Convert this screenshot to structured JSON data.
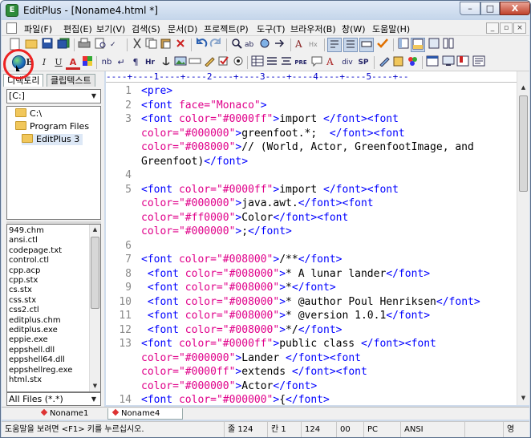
{
  "window": {
    "title": "EditPlus - [Noname4.html *]",
    "app_icon": "E",
    "min": "–",
    "max": "□",
    "close": "X"
  },
  "menu": [
    "파일(F)",
    "편집(E)",
    "보기(V)",
    "검색(S)",
    "문서(D)",
    "프로젝트(P)",
    "도구(T)",
    "브라우저(B)",
    "창(W)",
    "도움말(H)"
  ],
  "mdi_controls": [
    "_",
    "▫",
    "×"
  ],
  "toolbar2": {
    "bold": "B",
    "italic": "I",
    "underline": "U",
    "font_color": "A",
    "nbsp": "nb",
    "br": "↵",
    "para": "¶",
    "hr": "Hr",
    "pre": "PRE",
    "div": "div",
    "span": "SP"
  },
  "left_panel": {
    "tab_directory": "디렉토리",
    "tab_cliptext": "클립텍스트",
    "drive": "[C:]",
    "dirs": [
      "C:\\",
      "Program Files",
      "EditPlus 3"
    ],
    "files": [
      "949.chm",
      "ansi.ctl",
      "codepage.txt",
      "control.ctl",
      "cpp.acp",
      "cpp.stx",
      "cs.stx",
      "css.stx",
      "css2.ctl",
      "editplus.chm",
      "editplus.exe",
      "eppie.exe",
      "eppshell.dll",
      "eppshell64.dll",
      "eppshellreg.exe",
      "html.stx"
    ],
    "filter": "All Files (*.*)"
  },
  "ruler": "----+----1----+----2----+----3----+----4----+----5----+--",
  "editor": {
    "lines": [
      {
        "n": "1",
        "segs": [
          [
            "tag",
            "<pre>"
          ]
        ]
      },
      {
        "n": "2",
        "segs": [
          [
            "tag",
            "<font "
          ],
          [
            "attr",
            "face="
          ],
          [
            "attr",
            "\"Monaco\""
          ],
          [
            "tag",
            ">"
          ]
        ]
      },
      {
        "n": "3",
        "segs": [
          [
            "tag",
            "<font "
          ],
          [
            "attr",
            "color="
          ],
          [
            "attr",
            "\"#0000ff\""
          ],
          [
            "tag",
            ">"
          ],
          [
            "txt",
            "import "
          ],
          [
            "tag",
            "</font><font"
          ]
        ]
      },
      {
        "n": "",
        "segs": [
          [
            "attr",
            "color="
          ],
          [
            "attr",
            "\"#000000\""
          ],
          [
            "tag",
            ">"
          ],
          [
            "txt",
            "greenfoot.*;  "
          ],
          [
            "tag",
            "</font><font"
          ]
        ]
      },
      {
        "n": "",
        "segs": [
          [
            "attr",
            "color="
          ],
          [
            "attr",
            "\"#008000\""
          ],
          [
            "tag",
            ">"
          ],
          [
            "txt",
            "// (World, Actor, GreenfootImage, and"
          ]
        ]
      },
      {
        "n": "",
        "segs": [
          [
            "txt",
            "Greenfoot)"
          ],
          [
            "tag",
            "</font>"
          ]
        ]
      },
      {
        "n": "4",
        "segs": []
      },
      {
        "n": "5",
        "segs": [
          [
            "tag",
            "<font "
          ],
          [
            "attr",
            "color="
          ],
          [
            "attr",
            "\"#0000ff\""
          ],
          [
            "tag",
            ">"
          ],
          [
            "txt",
            "import "
          ],
          [
            "tag",
            "</font><font"
          ]
        ]
      },
      {
        "n": "",
        "segs": [
          [
            "attr",
            "color="
          ],
          [
            "attr",
            "\"#000000\""
          ],
          [
            "tag",
            ">"
          ],
          [
            "txt",
            "java.awt."
          ],
          [
            "tag",
            "</font><font"
          ]
        ]
      },
      {
        "n": "",
        "segs": [
          [
            "attr",
            "color="
          ],
          [
            "attr",
            "\"#ff0000\""
          ],
          [
            "tag",
            ">"
          ],
          [
            "txt",
            "Color"
          ],
          [
            "tag",
            "</font><font"
          ]
        ]
      },
      {
        "n": "",
        "segs": [
          [
            "attr",
            "color="
          ],
          [
            "attr",
            "\"#000000\""
          ],
          [
            "tag",
            ">"
          ],
          [
            "txt",
            ";"
          ],
          [
            "tag",
            "</font>"
          ]
        ]
      },
      {
        "n": "6",
        "segs": []
      },
      {
        "n": "7",
        "segs": [
          [
            "tag",
            "<font "
          ],
          [
            "attr",
            "color="
          ],
          [
            "attr",
            "\"#008000\""
          ],
          [
            "tag",
            ">"
          ],
          [
            "txt",
            "/**"
          ],
          [
            "tag",
            "</font>"
          ]
        ]
      },
      {
        "n": "8",
        "segs": [
          [
            "tag",
            " <font "
          ],
          [
            "attr",
            "color="
          ],
          [
            "attr",
            "\"#008000\""
          ],
          [
            "tag",
            ">"
          ],
          [
            "txt",
            "* A lunar lander"
          ],
          [
            "tag",
            "</font>"
          ]
        ]
      },
      {
        "n": "9",
        "segs": [
          [
            "tag",
            " <font "
          ],
          [
            "attr",
            "color="
          ],
          [
            "attr",
            "\"#008000\""
          ],
          [
            "tag",
            ">"
          ],
          [
            "txt",
            "*"
          ],
          [
            "tag",
            "</font>"
          ]
        ]
      },
      {
        "n": "10",
        "segs": [
          [
            "tag",
            " <font "
          ],
          [
            "attr",
            "color="
          ],
          [
            "attr",
            "\"#008000\""
          ],
          [
            "tag",
            ">"
          ],
          [
            "txt",
            "* @author Poul Henriksen"
          ],
          [
            "tag",
            "</font>"
          ]
        ]
      },
      {
        "n": "11",
        "segs": [
          [
            "tag",
            " <font "
          ],
          [
            "attr",
            "color="
          ],
          [
            "attr",
            "\"#008000\""
          ],
          [
            "tag",
            ">"
          ],
          [
            "txt",
            "* @version 1.0.1"
          ],
          [
            "tag",
            "</font>"
          ]
        ]
      },
      {
        "n": "12",
        "segs": [
          [
            "tag",
            " <font "
          ],
          [
            "attr",
            "color="
          ],
          [
            "attr",
            "\"#008000\""
          ],
          [
            "tag",
            ">"
          ],
          [
            "txt",
            "*/"
          ],
          [
            "tag",
            "</font>"
          ]
        ]
      },
      {
        "n": "13",
        "segs": [
          [
            "tag",
            "<font "
          ],
          [
            "attr",
            "color="
          ],
          [
            "attr",
            "\"#0000ff\""
          ],
          [
            "tag",
            ">"
          ],
          [
            "txt",
            "public class "
          ],
          [
            "tag",
            "</font><font"
          ]
        ]
      },
      {
        "n": "",
        "segs": [
          [
            "attr",
            "color="
          ],
          [
            "attr",
            "\"#000000\""
          ],
          [
            "tag",
            ">"
          ],
          [
            "txt",
            "Lander "
          ],
          [
            "tag",
            "</font><font"
          ]
        ]
      },
      {
        "n": "",
        "segs": [
          [
            "attr",
            "color="
          ],
          [
            "attr",
            "\"#0000ff\""
          ],
          [
            "tag",
            ">"
          ],
          [
            "txt",
            "extends "
          ],
          [
            "tag",
            "</font><font"
          ]
        ]
      },
      {
        "n": "",
        "segs": [
          [
            "attr",
            "color="
          ],
          [
            "attr",
            "\"#000000\""
          ],
          [
            "tag",
            ">"
          ],
          [
            "txt",
            "Actor"
          ],
          [
            "tag",
            "</font>"
          ]
        ]
      },
      {
        "n": "14",
        "segs": [
          [
            "tag",
            "<font "
          ],
          [
            "attr",
            "color="
          ],
          [
            "attr",
            "\"#000000\""
          ],
          [
            "tag",
            ">"
          ],
          [
            "txt",
            "{"
          ],
          [
            "tag",
            "</font>"
          ]
        ]
      }
    ]
  },
  "doc_tabs": [
    "Noname1",
    "Noname4"
  ],
  "status": {
    "help": "도움말을 보려면 <F1> 키를 누르십시오.",
    "line": "줄 124",
    "col": "칸 1",
    "total": "124",
    "code": "00",
    "eol": "PC",
    "encoding": "ANSI",
    "ime": "영"
  },
  "colors": {
    "tag": "#0000ff",
    "attr": "#e0008a",
    "ruler": "#0000c8",
    "highlight": "#e22222"
  }
}
